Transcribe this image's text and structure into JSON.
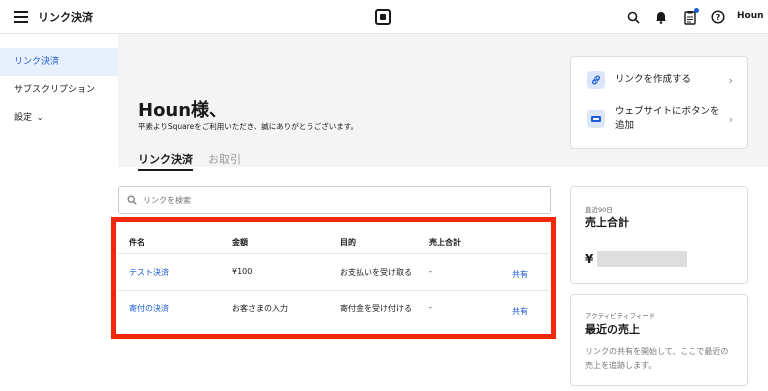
{
  "topbar": {
    "title": "リンク決済",
    "user": "Houn"
  },
  "sidebar": {
    "items": [
      {
        "label": "リンク決済"
      },
      {
        "label": "サブスクリプション"
      },
      {
        "label": "設定"
      }
    ]
  },
  "main": {
    "greeting": "Houn様、",
    "subtitle": "平素よりSquareをご利用いただき、誠にありがとうございます。",
    "tabs": [
      {
        "label": "リンク決済"
      },
      {
        "label": "お取引"
      }
    ]
  },
  "actions": {
    "create_link": "リンクを作成する",
    "website_button_line1": "ウェブサイトにボタンを",
    "website_button_line2": "追加"
  },
  "search": {
    "placeholder": "リンクを検索"
  },
  "table": {
    "headers": [
      "件名",
      "金額",
      "目的",
      "売上合計"
    ],
    "rows": [
      {
        "name": "テスト決済",
        "amount": "¥100",
        "purpose": "お支払いを受け取る",
        "total": "-",
        "share": "共有"
      },
      {
        "name": "寄付の決済",
        "amount": "お客さまの入力",
        "purpose": "寄付金を受け付ける",
        "total": "-",
        "share": "共有"
      }
    ]
  },
  "sales": {
    "period": "直近90日",
    "title": "売上合計",
    "currency": "¥"
  },
  "feed": {
    "label": "アクティビティフィード",
    "title": "最近の売上",
    "description": "リンクの共有を開始して、ここで最近の売上を追跡します。"
  },
  "colors": {
    "accent": "#1a5bd6",
    "highlight_frame": "#f2280a",
    "notification_dot": "#1a5bd6"
  },
  "icons": [
    "hamburger-icon",
    "square-logo-icon",
    "search-icon",
    "bell-icon",
    "clipboard-icon",
    "help-icon",
    "link-icon",
    "web-button-icon",
    "chevron-right-icon",
    "chevron-down-icon"
  ]
}
